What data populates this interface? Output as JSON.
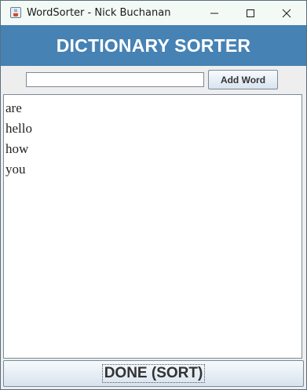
{
  "window": {
    "title": "WordSorter - Nick Buchanan"
  },
  "header": {
    "title": "DICTIONARY SORTER",
    "background": "#4682b4"
  },
  "input_row": {
    "word_input_value": "",
    "add_button_label": "Add Word"
  },
  "word_list": {
    "items": [
      "are",
      "hello",
      "how",
      "you"
    ]
  },
  "footer": {
    "done_button_label": "DONE (SORT)"
  },
  "icons": {
    "app": "java-cup-icon",
    "minimize": "minimize-icon",
    "maximize": "maximize-icon",
    "close": "close-icon"
  }
}
